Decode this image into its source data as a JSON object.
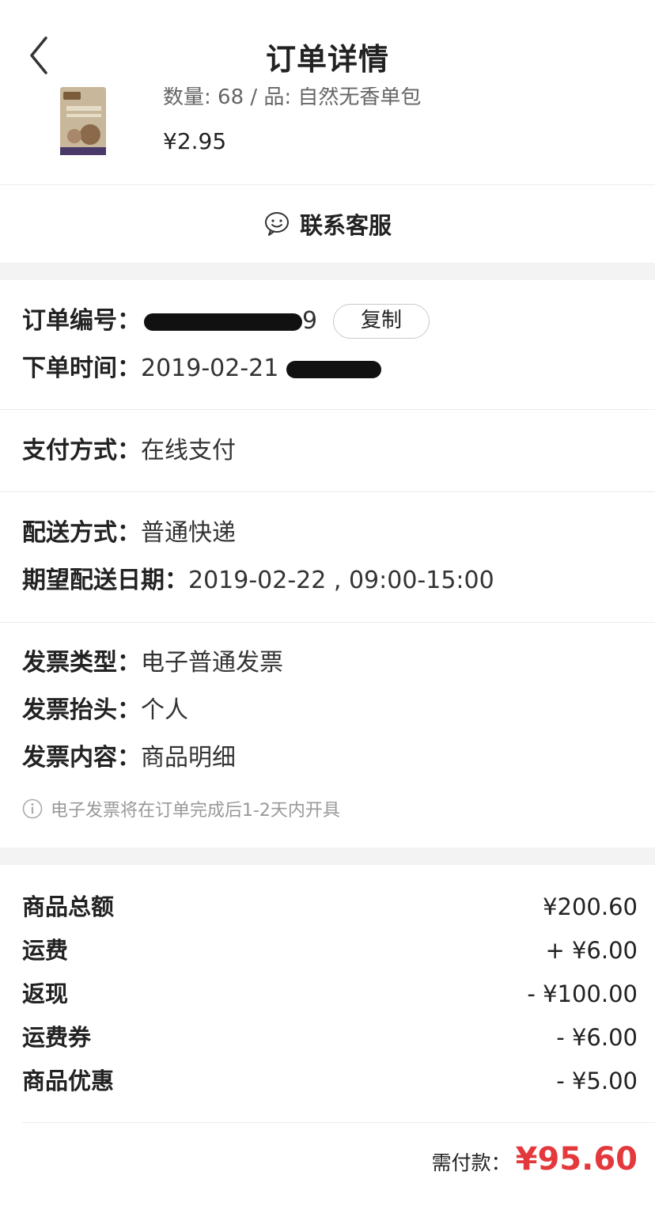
{
  "header": {
    "title": "订单详情"
  },
  "product": {
    "spec": "数量: 68 / 品: 自然无香单包",
    "price": "¥2.95"
  },
  "service": {
    "label": "联系客服"
  },
  "order": {
    "number_label": "订单编号：",
    "number_tail": "9",
    "copy_label": "复制",
    "time_label": "下单时间：",
    "time_value": "2019-02-21"
  },
  "payment": {
    "label": "支付方式：",
    "value": "在线支付"
  },
  "delivery": {
    "method_label": "配送方式：",
    "method_value": "普通快递",
    "date_label": "期望配送日期：",
    "date_value": "2019-02-22 , 09:00-15:00"
  },
  "invoice": {
    "type_label": "发票类型：",
    "type_value": "电子普通发票",
    "title_label": "发票抬头：",
    "title_value": "个人",
    "content_label": "发票内容：",
    "content_value": "商品明细",
    "note": "电子发票将在订单完成后1-2天内开具"
  },
  "summary": [
    {
      "label": "商品总额",
      "amount": "¥200.60"
    },
    {
      "label": "运费",
      "amount": "+ ¥6.00"
    },
    {
      "label": "返现",
      "amount": "- ¥100.00"
    },
    {
      "label": "运费券",
      "amount": "- ¥6.00"
    },
    {
      "label": "商品优惠",
      "amount": "- ¥5.00"
    }
  ],
  "total": {
    "label": "需付款：",
    "amount": "¥95.60"
  },
  "colors": {
    "accent": "#e4393c",
    "divider": "#ececec",
    "gap": "#f3f3f3"
  }
}
